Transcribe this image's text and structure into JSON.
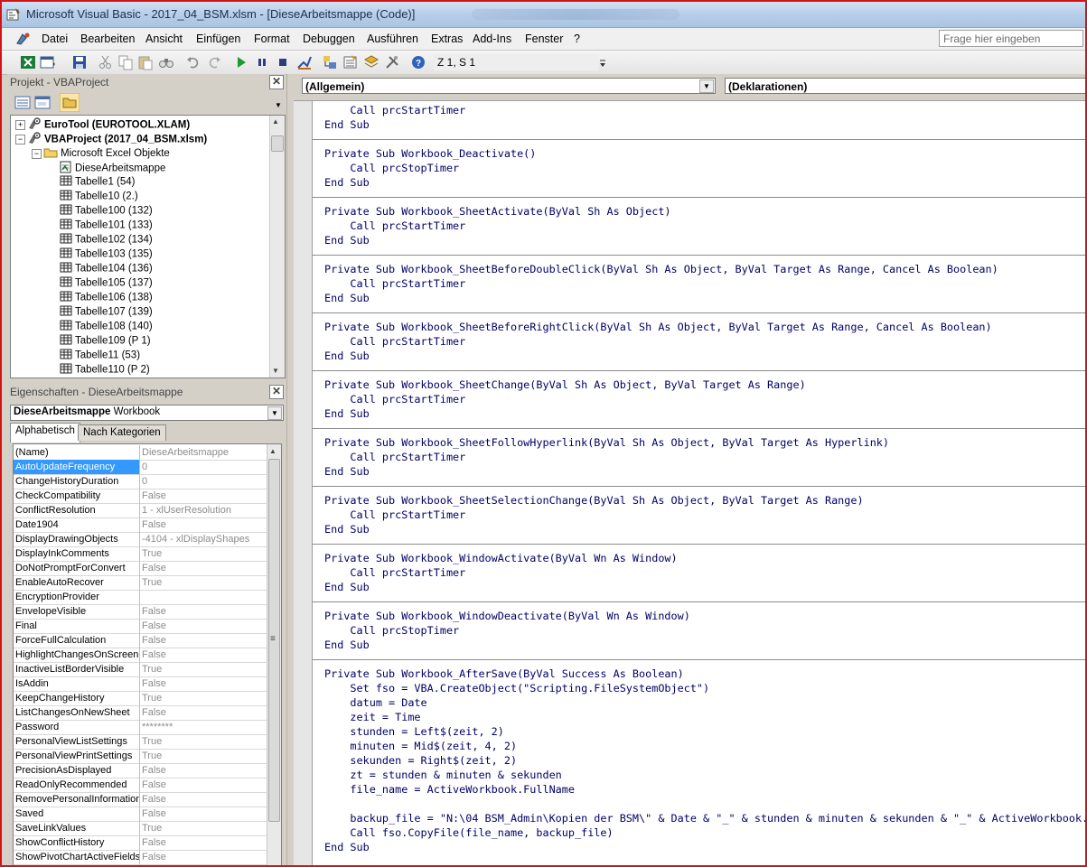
{
  "window": {
    "title": "Microsoft Visual Basic - 2017_04_BSM.xlsm - [DieseArbeitsmappe (Code)]"
  },
  "menu": {
    "items": [
      "Datei",
      "Bearbeiten",
      "Ansicht",
      "Einfügen",
      "Format",
      "Debuggen",
      "Ausführen",
      "Extras",
      "Add-Ins",
      "Fenster",
      "?"
    ],
    "help_placeholder": "Frage hier eingeben"
  },
  "toolbar": {
    "position": "Z 1, S 1"
  },
  "project_pane": {
    "title": "Projekt - VBAProject",
    "nodes": [
      {
        "label": "EuroTool (EUROTOOL.XLAM)"
      },
      {
        "label": "VBAProject (2017_04_BSM.xlsm)"
      },
      {
        "label": "Microsoft Excel Objekte"
      },
      {
        "label": "DieseArbeitsmappe"
      },
      {
        "label": "Tabelle1 (54)"
      },
      {
        "label": "Tabelle10 (2.)"
      },
      {
        "label": "Tabelle100 (132)"
      },
      {
        "label": "Tabelle101 (133)"
      },
      {
        "label": "Tabelle102 (134)"
      },
      {
        "label": "Tabelle103 (135)"
      },
      {
        "label": "Tabelle104 (136)"
      },
      {
        "label": "Tabelle105 (137)"
      },
      {
        "label": "Tabelle106 (138)"
      },
      {
        "label": "Tabelle107 (139)"
      },
      {
        "label": "Tabelle108 (140)"
      },
      {
        "label": "Tabelle109 (P 1)"
      },
      {
        "label": "Tabelle11 (53)"
      },
      {
        "label": "Tabelle110 (P 2)"
      }
    ]
  },
  "properties_pane": {
    "title": "Eigenschaften - DieseArbeitsmappe",
    "object_name": "DieseArbeitsmappe",
    "object_type": "Workbook",
    "tabs": [
      "Alphabetisch",
      "Nach Kategorien"
    ],
    "rows": [
      {
        "name": "(Name)",
        "value": "DieseArbeitsmappe"
      },
      {
        "name": "AutoUpdateFrequency",
        "value": "0"
      },
      {
        "name": "ChangeHistoryDuration",
        "value": "0"
      },
      {
        "name": "CheckCompatibility",
        "value": "False"
      },
      {
        "name": "ConflictResolution",
        "value": "1 - xlUserResolution"
      },
      {
        "name": "Date1904",
        "value": "False"
      },
      {
        "name": "DisplayDrawingObjects",
        "value": "-4104 - xlDisplayShapes"
      },
      {
        "name": "DisplayInkComments",
        "value": "True"
      },
      {
        "name": "DoNotPromptForConvert",
        "value": "False"
      },
      {
        "name": "EnableAutoRecover",
        "value": "True"
      },
      {
        "name": "EncryptionProvider",
        "value": ""
      },
      {
        "name": "EnvelopeVisible",
        "value": "False"
      },
      {
        "name": "Final",
        "value": "False"
      },
      {
        "name": "ForceFullCalculation",
        "value": "False"
      },
      {
        "name": "HighlightChangesOnScreen",
        "value": "False"
      },
      {
        "name": "InactiveListBorderVisible",
        "value": "True"
      },
      {
        "name": "IsAddin",
        "value": "False"
      },
      {
        "name": "KeepChangeHistory",
        "value": "True"
      },
      {
        "name": "ListChangesOnNewSheet",
        "value": "False"
      },
      {
        "name": "Password",
        "value": "********"
      },
      {
        "name": "PersonalViewListSettings",
        "value": "True"
      },
      {
        "name": "PersonalViewPrintSettings",
        "value": "True"
      },
      {
        "name": "PrecisionAsDisplayed",
        "value": "False"
      },
      {
        "name": "ReadOnlyRecommended",
        "value": "False"
      },
      {
        "name": "RemovePersonalInformation",
        "value": "False"
      },
      {
        "name": "Saved",
        "value": "False"
      },
      {
        "name": "SaveLinkValues",
        "value": "True"
      },
      {
        "name": "ShowConflictHistory",
        "value": "False"
      },
      {
        "name": "ShowPivotChartActiveFields",
        "value": "False"
      }
    ]
  },
  "code_window": {
    "object_combo": "(Allgemein)",
    "proc_combo": "(Deklarationen)",
    "lines": [
      "    Call prcStartTimer",
      "End Sub",
      "",
      "Private Sub Workbook_Deactivate()",
      "    Call prcStopTimer",
      "End Sub",
      "",
      "Private Sub Workbook_SheetActivate(ByVal Sh As Object)",
      "    Call prcStartTimer",
      "End Sub",
      "",
      "Private Sub Workbook_SheetBeforeDoubleClick(ByVal Sh As Object, ByVal Target As Range, Cancel As Boolean)",
      "    Call prcStartTimer",
      "End Sub",
      "",
      "Private Sub Workbook_SheetBeforeRightClick(ByVal Sh As Object, ByVal Target As Range, Cancel As Boolean)",
      "    Call prcStartTimer",
      "End Sub",
      "",
      "Private Sub Workbook_SheetChange(ByVal Sh As Object, ByVal Target As Range)",
      "    Call prcStartTimer",
      "End Sub",
      "",
      "Private Sub Workbook_SheetFollowHyperlink(ByVal Sh As Object, ByVal Target As Hyperlink)",
      "    Call prcStartTimer",
      "End Sub",
      "",
      "Private Sub Workbook_SheetSelectionChange(ByVal Sh As Object, ByVal Target As Range)",
      "    Call prcStartTimer",
      "End Sub",
      "",
      "Private Sub Workbook_WindowActivate(ByVal Wn As Window)",
      "    Call prcStartTimer",
      "End Sub",
      "",
      "Private Sub Workbook_WindowDeactivate(ByVal Wn As Window)",
      "    Call prcStopTimer",
      "End Sub",
      "",
      "Private Sub Workbook_AfterSave(ByVal Success As Boolean)",
      "    Set fso = VBA.CreateObject(\"Scripting.FileSystemObject\")",
      "    datum = Date",
      "    zeit = Time",
      "    stunden = Left$(zeit, 2)",
      "    minuten = Mid$(zeit, 4, 2)",
      "    sekunden = Right$(zeit, 2)",
      "    zt = stunden & minuten & sekunden",
      "    file_name = ActiveWorkbook.FullName",
      "",
      "    backup_file = \"N:\\04 BSM_Admin\\Kopien der BSM\\\" & Date & \"_\" & stunden & minuten & sekunden & \"_\" & ActiveWorkbook.Name",
      "    Call fso.CopyFile(file_name, backup_file)",
      "End Sub"
    ]
  }
}
